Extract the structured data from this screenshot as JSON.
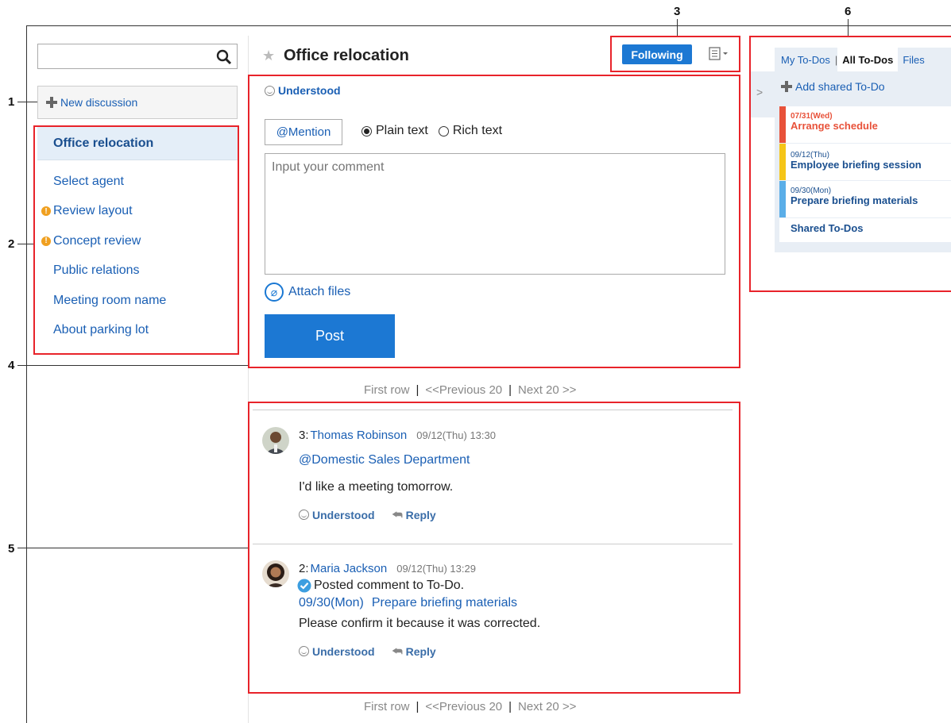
{
  "callouts": [
    "1",
    "2",
    "3",
    "4",
    "5",
    "6"
  ],
  "search": {
    "placeholder": "",
    "icon": "search-icon"
  },
  "sidebar": {
    "new_discussion": "New discussion",
    "items": [
      {
        "label": "Office relocation",
        "active": true,
        "unread": false
      },
      {
        "label": "Select agent",
        "unread": false
      },
      {
        "label": "Review layout",
        "unread": true
      },
      {
        "label": "Concept review",
        "unread": true
      },
      {
        "label": "Public relations",
        "unread": false
      },
      {
        "label": "Meeting room name",
        "unread": false
      },
      {
        "label": "About parking lot",
        "unread": false
      }
    ]
  },
  "header": {
    "title": "Office relocation",
    "following": "Following"
  },
  "composer": {
    "understood": "Understood",
    "mention": "@Mention",
    "plain_text": "Plain text",
    "rich_text": "Rich text",
    "comment_placeholder": "Input your comment",
    "attach": "Attach files",
    "post": "Post"
  },
  "pager": {
    "first": "First row",
    "prev": "<<Previous 20",
    "next": "Next 20 >>",
    "sep": "|"
  },
  "posts": [
    {
      "number": "3:",
      "author": "Thomas Robinson",
      "time": "09/12(Thu) 13:30",
      "mention": "@Domestic Sales Department",
      "body": "I'd like a meeting tomorrow.",
      "understood": "Understood",
      "reply": "Reply"
    },
    {
      "number": "2:",
      "author": "Maria Jackson",
      "time": "09/12(Thu) 13:29",
      "todo_note": "Posted comment to To-Do.",
      "todo_date": "09/30(Mon)",
      "todo_title": "Prepare briefing materials",
      "body": "Please confirm it because it was corrected.",
      "understood": "Understood",
      "reply": "Reply"
    }
  ],
  "todos_panel": {
    "tabs": [
      "My To-Dos",
      "All To-Dos",
      "Files"
    ],
    "add": "Add shared To-Do",
    "items": [
      {
        "date": "07/31(Wed)",
        "title": "Arrange schedule",
        "color": "#e8523a",
        "overdue": true
      },
      {
        "date": "09/12(Thu)",
        "title": "Employee briefing session",
        "color": "#f5c518",
        "overdue": false
      },
      {
        "date": "09/30(Mon)",
        "title": "Prepare briefing materials",
        "color": "#5aaee8",
        "overdue": false
      }
    ],
    "shared": "Shared To-Dos"
  },
  "colors": {
    "accent": "#1c78d3",
    "callout": "#e8232a",
    "link": "#1a5fb4"
  }
}
